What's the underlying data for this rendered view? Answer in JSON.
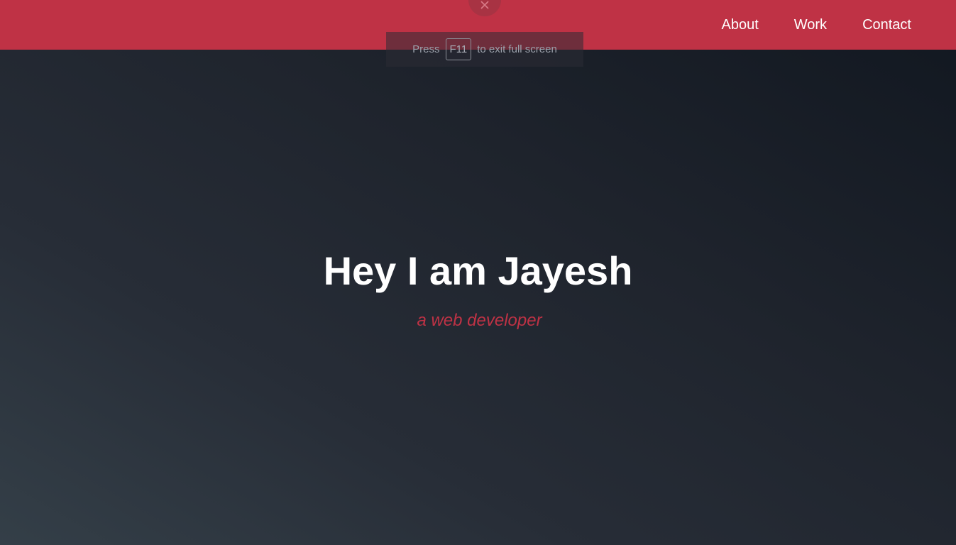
{
  "nav": {
    "links": [
      {
        "label": "About"
      },
      {
        "label": "Work"
      },
      {
        "label": "Contact"
      }
    ]
  },
  "fullscreen_banner": {
    "prefix": "Press",
    "key": "F11",
    "suffix": "to exit full screen",
    "close_icon": "close-icon"
  },
  "hero": {
    "title": "Hey I am Jayesh",
    "subtitle": "a web developer"
  },
  "colors": {
    "accent": "#bf3245",
    "background_dark": "#1f242d",
    "text_light": "#ffffff"
  }
}
